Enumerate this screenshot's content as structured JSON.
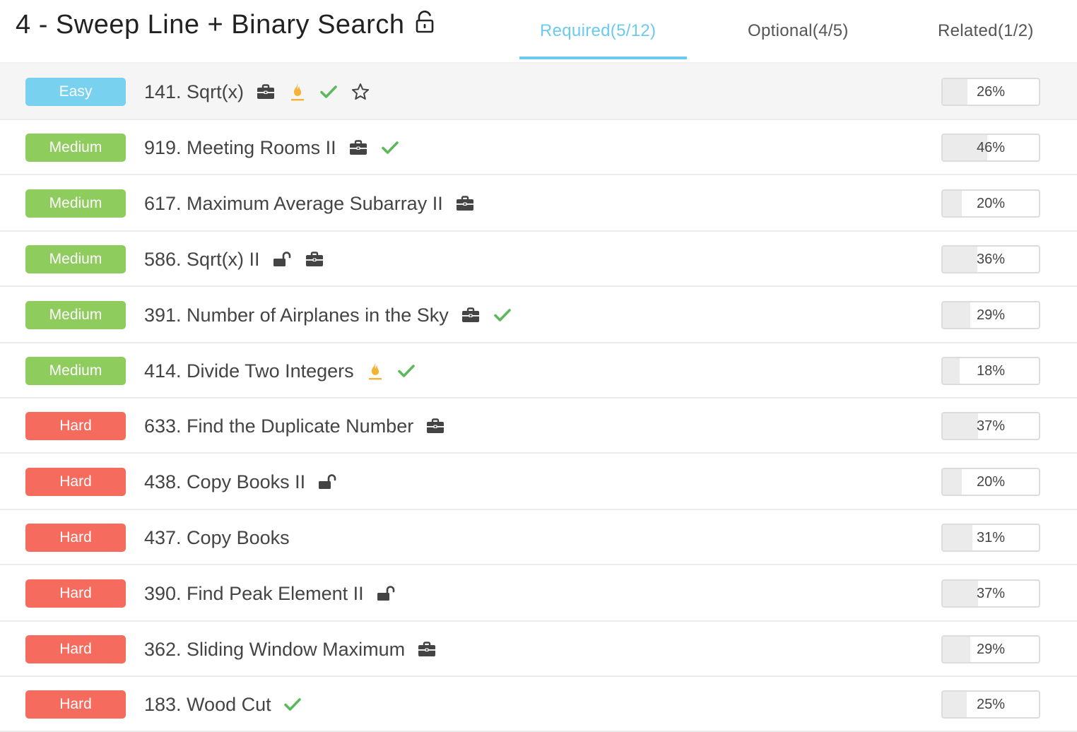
{
  "header": {
    "title": "4 - Sweep Line + Binary Search",
    "tabs": [
      {
        "label": "Required(5/12)",
        "active": true
      },
      {
        "label": "Optional(4/5)",
        "active": false
      },
      {
        "label": "Related(1/2)",
        "active": false
      }
    ]
  },
  "colors": {
    "accent": "#6cc9ef",
    "easy": "#79d1f0",
    "medium": "#8fcc5e",
    "hard": "#f56b5d",
    "check": "#5cb85c",
    "flame": "#f5b335"
  },
  "problems": [
    {
      "level": "Easy",
      "name": "141. Sqrt(x)",
      "icons": [
        "briefcase-icon",
        "flame-icon",
        "check-icon",
        "star-icon"
      ],
      "rate": "26%",
      "rate_value": 26
    },
    {
      "level": "Medium",
      "name": "919. Meeting Rooms II",
      "icons": [
        "briefcase-icon",
        "check-icon"
      ],
      "rate": "46%",
      "rate_value": 46
    },
    {
      "level": "Medium",
      "name": "617. Maximum Average Subarray II",
      "icons": [
        "briefcase-icon"
      ],
      "rate": "20%",
      "rate_value": 20
    },
    {
      "level": "Medium",
      "name": "586. Sqrt(x) II",
      "icons": [
        "unlock-icon",
        "briefcase-icon"
      ],
      "rate": "36%",
      "rate_value": 36
    },
    {
      "level": "Medium",
      "name": "391. Number of Airplanes in the Sky",
      "icons": [
        "briefcase-icon",
        "check-icon"
      ],
      "rate": "29%",
      "rate_value": 29
    },
    {
      "level": "Medium",
      "name": "414. Divide Two Integers",
      "icons": [
        "flame-icon",
        "check-icon"
      ],
      "rate": "18%",
      "rate_value": 18
    },
    {
      "level": "Hard",
      "name": "633. Find the Duplicate Number",
      "icons": [
        "briefcase-icon"
      ],
      "rate": "37%",
      "rate_value": 37
    },
    {
      "level": "Hard",
      "name": "438. Copy Books II",
      "icons": [
        "unlock-icon"
      ],
      "rate": "20%",
      "rate_value": 20
    },
    {
      "level": "Hard",
      "name": "437. Copy Books",
      "icons": [],
      "rate": "31%",
      "rate_value": 31
    },
    {
      "level": "Hard",
      "name": "390. Find Peak Element II",
      "icons": [
        "unlock-icon"
      ],
      "rate": "37%",
      "rate_value": 37
    },
    {
      "level": "Hard",
      "name": "362. Sliding Window Maximum",
      "icons": [
        "briefcase-icon"
      ],
      "rate": "29%",
      "rate_value": 29
    },
    {
      "level": "Hard",
      "name": "183. Wood Cut",
      "icons": [
        "check-icon"
      ],
      "rate": "25%",
      "rate_value": 25
    }
  ]
}
